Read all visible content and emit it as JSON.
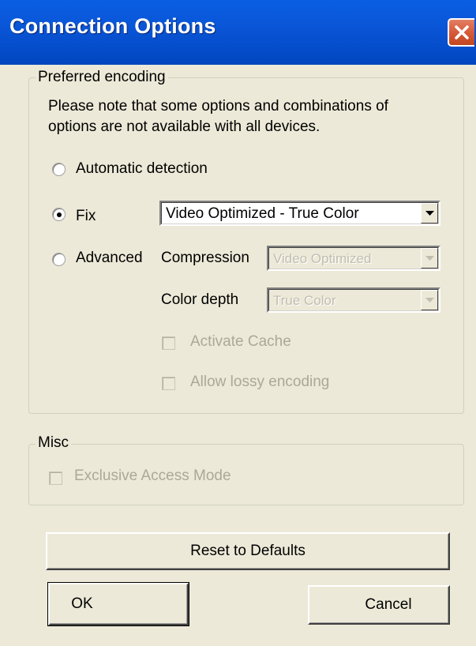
{
  "window": {
    "title": "Connection Options"
  },
  "encoding": {
    "group_label": "Preferred encoding",
    "note": "Please note that some options and combinations of options are not available with all devices.",
    "radio_auto": "Automatic detection",
    "radio_fix": "Fix",
    "radio_advanced": "Advanced",
    "selected": "Fix",
    "fix_value": "Video Optimized - True Color",
    "compression_label": "Compression",
    "compression_value": "Video Optimized",
    "color_depth_label": "Color depth",
    "color_depth_value": "True Color",
    "activate_cache": "Activate Cache",
    "allow_lossy": "Allow lossy encoding"
  },
  "misc": {
    "group_label": "Misc",
    "exclusive_access": "Exclusive Access Mode"
  },
  "buttons": {
    "reset": "Reset to Defaults",
    "ok": "OK",
    "cancel": "Cancel"
  }
}
